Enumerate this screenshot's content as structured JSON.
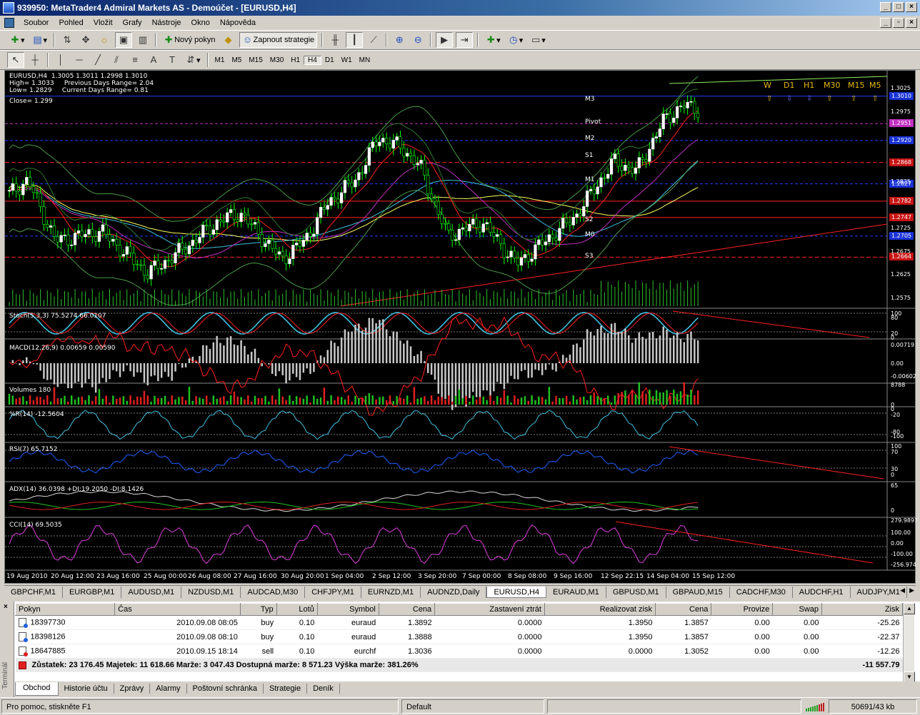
{
  "window": {
    "title": "939950: MetaTrader4 Admiral Markets AS - Demoúčet - [EURUSD,H4]"
  },
  "menu": [
    "Soubor",
    "Pohled",
    "Vložit",
    "Grafy",
    "Nástroje",
    "Okno",
    "Nápověda"
  ],
  "toolbar": {
    "new_order": "Nový pokyn",
    "strategy": "Zapnout strategie"
  },
  "timeframes": [
    "M1",
    "M5",
    "M15",
    "M30",
    "H1",
    "H4",
    "D1",
    "W1",
    "MN"
  ],
  "active_timeframe": "H4",
  "chart": {
    "header_line1": "EURUSD,H4  1.3005 1.3011 1.2998 1.3010",
    "header_line2": "High= 1.3033     Previous Days Range= 2.04",
    "header_line3": "Low= 1.2829     Current Days Range= 0.81",
    "header_line4": "Close= 1.299",
    "tf_labels": [
      "W",
      "D1",
      "H1",
      "M30",
      "M15",
      "M5"
    ],
    "tf_arrows": [
      "up",
      "down",
      "down",
      "up",
      "up",
      "up"
    ],
    "pivot_labels": [
      {
        "text": "M3",
        "price": 1.3004
      },
      {
        "text": "Pivot",
        "price": 1.2955
      },
      {
        "text": "M2",
        "price": 1.292
      },
      {
        "text": "S1",
        "price": 1.2882
      },
      {
        "text": "M1",
        "price": 1.283
      },
      {
        "text": "S2",
        "price": 1.2745
      },
      {
        "text": "M0",
        "price": 1.2713
      },
      {
        "text": "S3",
        "price": 1.2667
      }
    ],
    "price_axis": [
      "1.3025",
      "1.2975",
      "1.2825",
      "1.2725",
      "1.2675",
      "1.2625",
      "1.2575"
    ],
    "price_tags": [
      {
        "text": "1.3010",
        "color": "#1a33d6",
        "price": 1.301
      },
      {
        "text": "1.2951",
        "color": "#c030c0",
        "price": 1.2951
      },
      {
        "text": "1.2920",
        "color": "#1a33d6",
        "price": 1.2915
      },
      {
        "text": "1.2868",
        "color": "#c81414",
        "price": 1.2868
      },
      {
        "text": "1.2827",
        "color": "#1a33d6",
        "price": 1.2822
      },
      {
        "text": "1.2782",
        "color": "#c81414",
        "price": 1.2785
      },
      {
        "text": "1.2747",
        "color": "#c81414",
        "price": 1.275
      },
      {
        "text": "1.2705",
        "color": "#1a33d6",
        "price": 1.271
      },
      {
        "text": "1.2664",
        "color": "#c81414",
        "price": 1.2665
      }
    ],
    "indicators": {
      "stoch": {
        "label": "Stoch(5,3,3) 75.5274 66.0107",
        "axis": [
          "100",
          "80",
          "20",
          "0"
        ]
      },
      "macd": {
        "label": "MACD(12,26,9) 0.00659 0.00590",
        "axis": [
          "0.00719",
          "0.00",
          "-0.00602"
        ]
      },
      "volumes": {
        "label": "Volumes 180",
        "axis": [
          "8788",
          "0"
        ]
      },
      "wpr": {
        "label": "%R(14) -12.5604",
        "axis": [
          "0",
          "-20",
          "-80",
          "-100"
        ]
      },
      "rsi": {
        "label": "RSI(7) 65.7152",
        "axis": [
          "100",
          "70",
          "30",
          "0"
        ]
      },
      "adx": {
        "label": "ADX(14) 36.0398 +DI:19.2050 -DI:8.1426",
        "axis": [
          "65",
          "0"
        ]
      },
      "cci": {
        "label": "CCI(14) 69.5035",
        "axis": [
          "279.9897",
          "100.00",
          "0.00",
          "-100.00",
          "-256.974"
        ]
      }
    },
    "dates": [
      "19 Aug 2010",
      "20 Aug 12:00",
      "23 Aug 16:00",
      "25 Aug 00:00",
      "26 Aug 08:00",
      "27 Aug 16:00",
      "30 Aug 20:00",
      "1 Sep 04:00",
      "2 Sep 12:00",
      "3 Sep 20:00",
      "7 Sep 00:00",
      "8 Sep 08:00",
      "9 Sep 16:00",
      "12 Sep 22:15",
      "14 Sep 04:00",
      "15 Sep 12:00"
    ],
    "colors": {
      "bull": "#ffffff",
      "bear": "#00ff00",
      "ma_red": "#ff2020",
      "ma_yellow": "#ffff60",
      "ma_cyan": "#40c0e0",
      "bands": "#50a050"
    }
  },
  "chart_tabs": [
    "GBPCHF,M1",
    "EURGBP,M1",
    "AUDUSD,M1",
    "NZDUSD,M1",
    "AUDCAD,M30",
    "CHFJPY,M1",
    "EURNZD,M1",
    "AUDNZD,Daily",
    "EURUSD,H4",
    "EURAUD,M1",
    "GBPUSD,M1",
    "GBPAUD,M15",
    "CADCHF,M30",
    "AUDCHF,H1",
    "AUDJPY,M1"
  ],
  "active_chart_tab": "EURUSD,H4",
  "terminal": {
    "columns": [
      "Pokyn",
      "Čas",
      "Typ",
      "Lotů",
      "Symbol",
      "Cena",
      "Zastavení ztrát",
      "Realizovat zisk",
      "Cena",
      "Provize",
      "Swap",
      "Zisk"
    ],
    "orders": [
      {
        "id": "18397730",
        "time": "2010.09.08 08:05",
        "type": "buy",
        "lots": "0.10",
        "symbol": "euraud",
        "price": "1.3892",
        "sl": "0.0000",
        "tp": "1.3950",
        "cur": "1.3857",
        "commission": "0.00",
        "swap": "0.00",
        "profit": "-25.26"
      },
      {
        "id": "18398126",
        "time": "2010.09.08 08:10",
        "type": "buy",
        "lots": "0.10",
        "symbol": "euraud",
        "price": "1.3888",
        "sl": "0.0000",
        "tp": "1.3950",
        "cur": "1.3857",
        "commission": "0.00",
        "swap": "0.00",
        "profit": "-22.37"
      },
      {
        "id": "18647885",
        "time": "2010.09.15 18:14",
        "type": "sell",
        "lots": "0.10",
        "symbol": "eurchf",
        "price": "1.3036",
        "sl": "0.0000",
        "tp": "0.0000",
        "cur": "1.3052",
        "commission": "0.00",
        "swap": "0.00",
        "profit": "-12.26"
      }
    ],
    "balance_line": "Zůstatek: 23 176.45  Majetek: 11 618.66  Marže: 3 047.43  Dostupná marže: 8 571.23  Výška marže: 381.26%",
    "total_profit": "-11 557.79",
    "side_label": "Terminál",
    "tabs": [
      "Obchod",
      "Historie účtu",
      "Zprávy",
      "Alarmy",
      "Poštovní schránka",
      "Strategie",
      "Deník"
    ],
    "active_tab": "Obchod"
  },
  "status": {
    "help": "Pro pomoc, stiskněte F1",
    "profile": "Default",
    "traffic": "50691/43 kb"
  }
}
